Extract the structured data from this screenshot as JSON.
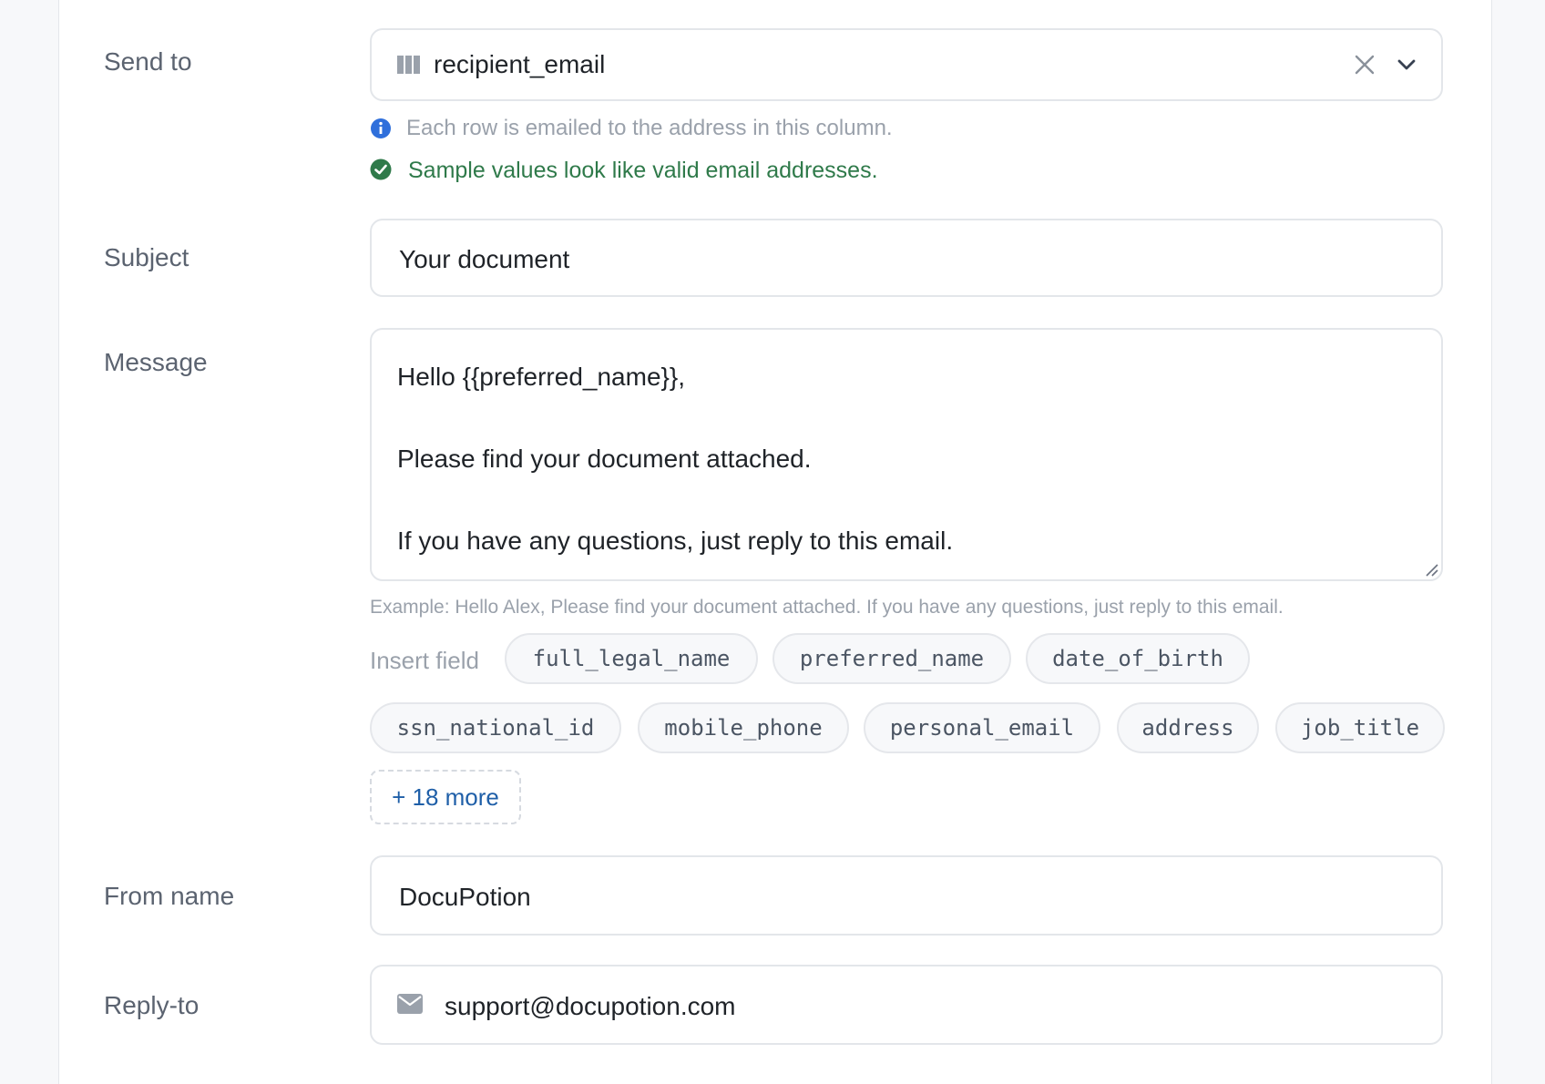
{
  "send_to": {
    "label": "Send to",
    "value": "recipient_email",
    "info_hint": "Each row is emailed to the address in this column.",
    "success_hint": "Sample values look like valid email addresses."
  },
  "subject": {
    "label": "Subject",
    "value": "Your document"
  },
  "message": {
    "label": "Message",
    "line1": "Hello {{preferred_name}},",
    "line2": "Please find your document attached.",
    "line3": "If you have any questions, just reply to this email.",
    "example": "Example: Hello Alex, Please find your document attached. If you have any questions, just reply to this email."
  },
  "insert_field": {
    "label": "Insert field",
    "chips": [
      "full_legal_name",
      "preferred_name",
      "date_of_birth",
      "ssn_national_id",
      "mobile_phone",
      "personal_email",
      "address",
      "job_title"
    ],
    "more_label": "+ 18 more"
  },
  "from_name": {
    "label": "From name",
    "value": "DocuPotion"
  },
  "reply_to": {
    "label": "Reply-to",
    "value": "support@docupotion.com"
  },
  "colors": {
    "info": "#2f6fdb",
    "success": "#2f7a4a",
    "link": "#1f5fa8",
    "muted": "#9aa1ab"
  }
}
